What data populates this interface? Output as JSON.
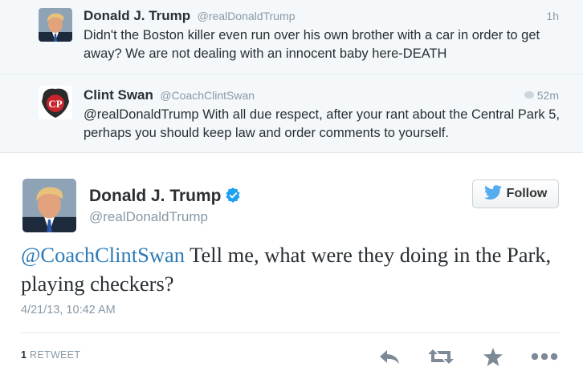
{
  "context_tweets": [
    {
      "name": "Donald J. Trump",
      "handle": "@realDonaldTrump",
      "time": "1h",
      "text": "Didn't the Boston killer even run over his own brother with a car in order to get away?  We are not dealing with an innocent baby here-DEATH"
    },
    {
      "name": "Clint Swan",
      "handle": "@CoachClintSwan",
      "time": "52m",
      "text": "@realDonaldTrump With all due respect, after your rant about the Central Park 5, perhaps you should keep law and order comments to yourself.",
      "avatar_text": "CP"
    }
  ],
  "main_tweet": {
    "name": "Donald J. Trump",
    "handle": "@realDonaldTrump",
    "follow_label": "Follow",
    "mention": "@CoachClintSwan",
    "text": " Tell me, what were they doing in the Park, playing checkers?",
    "date": "4/21/13, 10:42 AM",
    "retweet_count": "1",
    "retweet_label": "RETWEET"
  },
  "icons": [
    "verified-badge-icon",
    "twitter-bird-icon",
    "reply-icon",
    "retweet-icon",
    "favorite-star-icon",
    "more-dots-icon",
    "comment-bubble-icon"
  ],
  "colors": {
    "link": "#2b7bb9",
    "verified": "#1da1f2",
    "muted": "#8899a6",
    "twitter_blue": "#55acee"
  }
}
